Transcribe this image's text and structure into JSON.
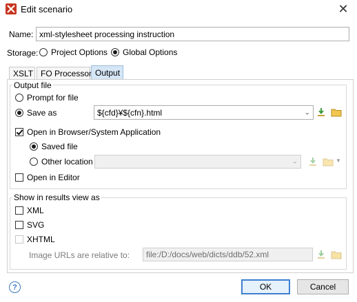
{
  "window": {
    "title": "Edit scenario"
  },
  "name": {
    "label": "Name:",
    "value": "xml-stylesheet processing instruction"
  },
  "storage": {
    "label": "Storage:",
    "options": [
      {
        "label": "Project Options",
        "selected": false
      },
      {
        "label": "Global Options",
        "selected": true
      }
    ]
  },
  "tabs": [
    {
      "label": "XSLT",
      "active": false
    },
    {
      "label": "FO Processor",
      "active": false
    },
    {
      "label": "Output",
      "active": true
    }
  ],
  "output_file": {
    "title": "Output file",
    "prompt_label": "Prompt for file",
    "save_as_label": "Save as",
    "save_as_value": "${cfd}¥${cfn}.html",
    "open_browser_label": "Open in Browser/System Application",
    "saved_file_label": "Saved file",
    "other_location_label": "Other location",
    "open_editor_label": "Open in Editor"
  },
  "results_view": {
    "title": "Show in results view as",
    "xml_label": "XML",
    "svg_label": "SVG",
    "xhtml_label": "XHTML",
    "image_urls_label": "Image URLs are relative to:",
    "image_urls_value": "file:/D:/docs/web/dicts/ddb/52.xml"
  },
  "buttons": {
    "ok": "OK",
    "cancel": "Cancel"
  },
  "colors": {
    "accent": "#3c7fd0",
    "tab_active": "#d5e6f6",
    "folder": "#e8b939",
    "download": "#3b9b3b"
  }
}
